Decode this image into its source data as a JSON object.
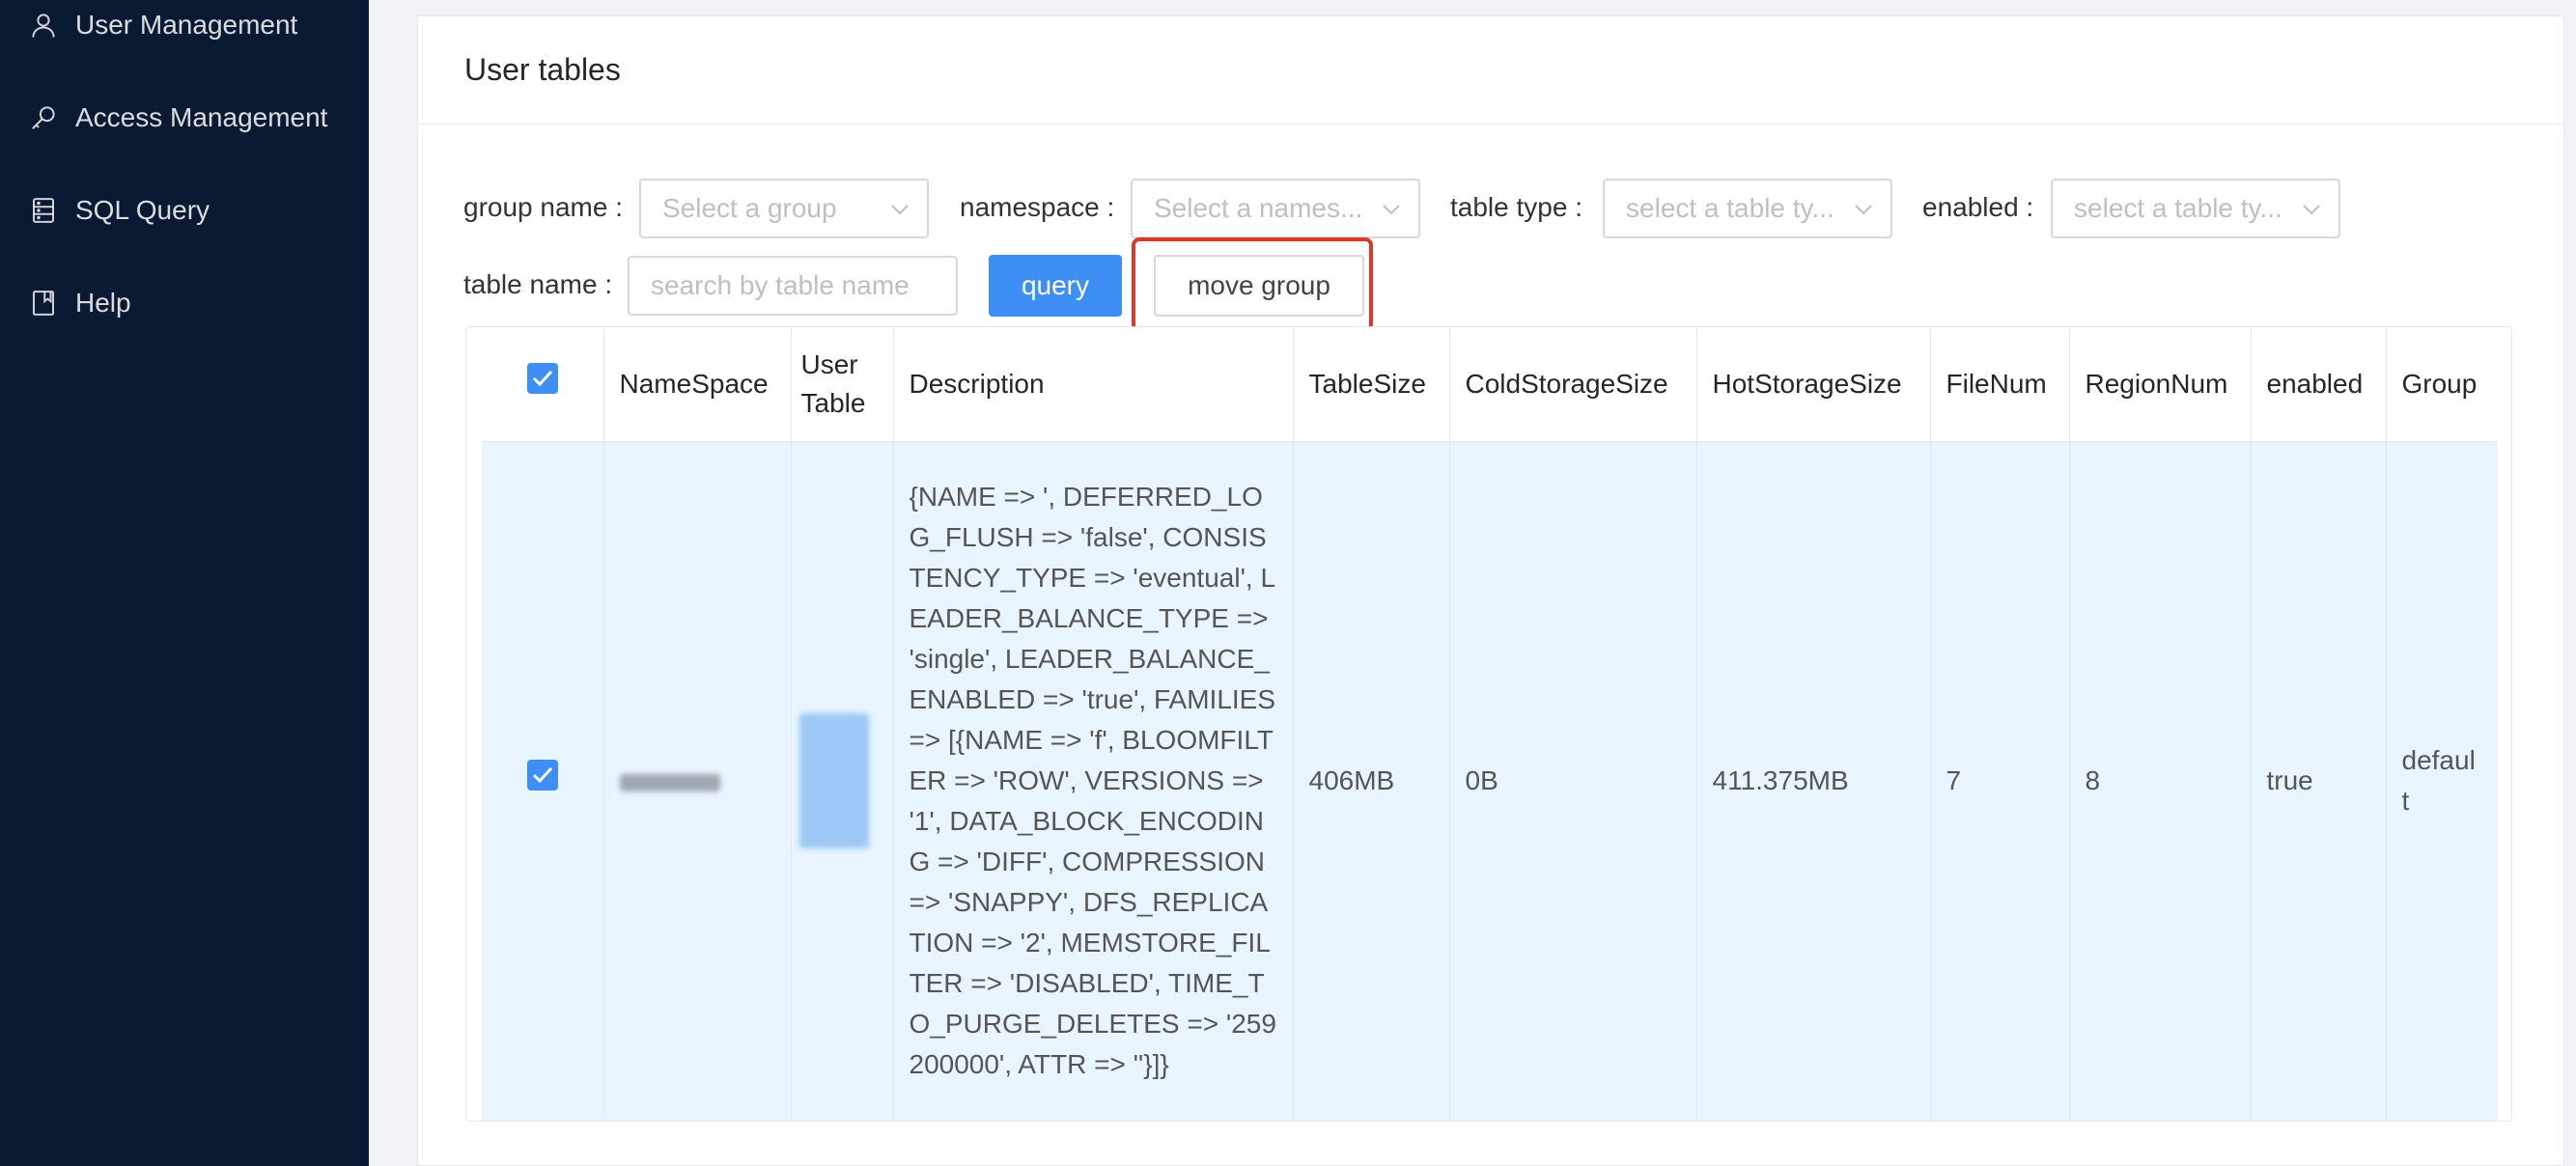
{
  "sidebar": {
    "items": [
      {
        "label": "User Management",
        "icon": "user-icon"
      },
      {
        "label": "Access Management",
        "icon": "key-icon"
      },
      {
        "label": "SQL Query",
        "icon": "database-icon"
      },
      {
        "label": "Help",
        "icon": "book-icon"
      }
    ]
  },
  "panel": {
    "title": "User tables"
  },
  "filters": {
    "group_label": "group name",
    "group_placeholder": "Select a group",
    "namespace_label": "namespace",
    "namespace_placeholder": "Select a names...",
    "table_type_label": "table type",
    "table_type_placeholder": "select a table ty...",
    "enabled_label": "enabled",
    "enabled_placeholder": "select a table ty...",
    "table_name_label": "table name",
    "table_name_placeholder": "search by table name"
  },
  "buttons": {
    "query": "query",
    "move_group": "move group"
  },
  "table": {
    "headers": [
      "NameSpace",
      "User Table",
      "Description",
      "TableSize",
      "ColdStorageSize",
      "HotStorageSize",
      "FileNum",
      "RegionNum",
      "enabled",
      "Group"
    ],
    "rows": [
      {
        "description": "{NAME => ', DEFERRED_LOG_FLUSH => 'false', CONSISTENCY_TYPE => 'eventual', LEADER_BALANCE_TYPE => 'single', LEADER_BALANCE_ENABLED => 'true', FAMILIES => [{NAME => 'f', BLOOMFILTER => 'ROW', VERSIONS => '1', DATA_BLOCK_ENCODING => 'DIFF', COMPRESSION => 'SNAPPY', DFS_REPLICATION => '2', MEMSTORE_FILTER => 'DISABLED', TIME_TO_PURGE_DELETES => '259200000', ATTR => ''}]}",
        "table_size": "406MB",
        "cold_storage_size": "0B",
        "hot_storage_size": "411.375MB",
        "file_num": "7",
        "region_num": "8",
        "enabled": "true",
        "group": "default"
      }
    ]
  },
  "colors": {
    "sidebar_bg": "#0a1a33",
    "primary": "#3d8ff5",
    "highlight": "#d9382e",
    "row_selected": "#e8f4fe"
  }
}
